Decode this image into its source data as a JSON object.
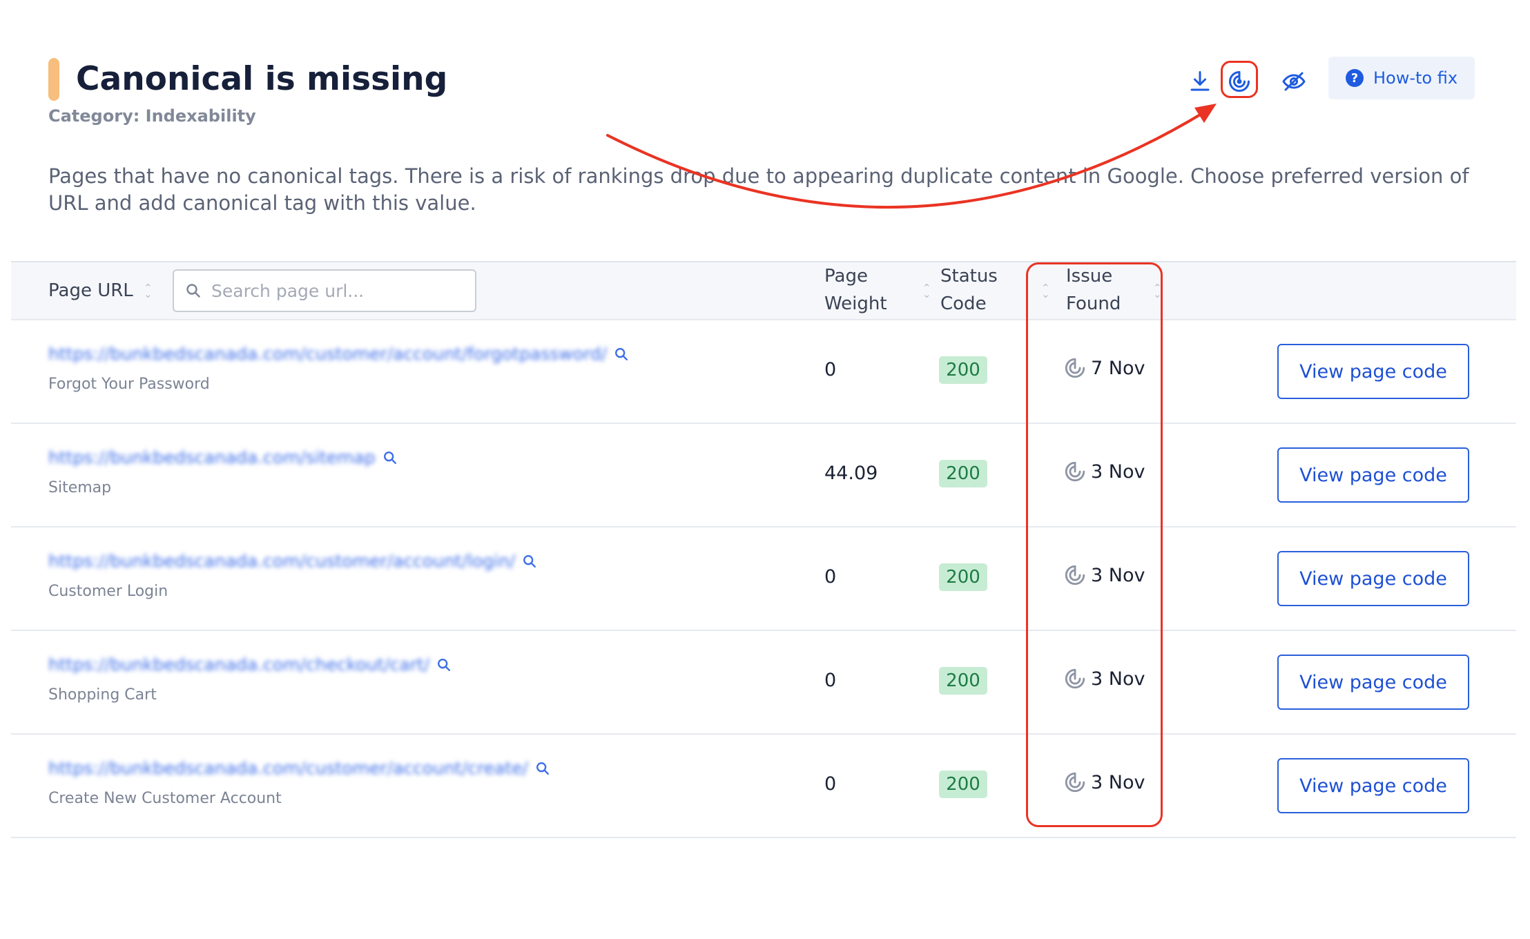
{
  "header": {
    "title": "Canonical is missing",
    "category": "Category: Indexability",
    "description": "Pages that have no canonical tags. There is a risk of rankings drop due to appearing duplicate content in Google. Choose preferred version of URL and add canonical tag with this value.",
    "accent_color": "#f7be7d"
  },
  "toolbar": {
    "download_icon": "download-icon",
    "issue_history_icon": "radar-icon",
    "hide_icon": "eye-off-icon",
    "howto_label": "How-to fix",
    "accent_color": "#1e5be0"
  },
  "table": {
    "columns": {
      "page_url": "Page URL",
      "search_placeholder": "Search page url...",
      "weight_line1": "Page",
      "weight_line2": "Weight",
      "status_line1": "Status",
      "status_line2": "Code",
      "found_line1": "Issue",
      "found_line2": "Found"
    },
    "rows": [
      {
        "url": "https://bunkbedscanada.com/customer/account/forgotpassword/",
        "title": "Forgot Your Password",
        "weight": "0",
        "status": "200",
        "found": "7 Nov",
        "action": "View page code"
      },
      {
        "url": "https://bunkbedscanada.com/sitemap",
        "title": "Sitemap",
        "weight": "44.09",
        "status": "200",
        "found": "3 Nov",
        "action": "View page code"
      },
      {
        "url": "https://bunkbedscanada.com/customer/account/login/",
        "title": "Customer Login",
        "weight": "0",
        "status": "200",
        "found": "3 Nov",
        "action": "View page code"
      },
      {
        "url": "https://bunkbedscanada.com/checkout/cart/",
        "title": "Shopping Cart",
        "weight": "0",
        "status": "200",
        "found": "3 Nov",
        "action": "View page code"
      },
      {
        "url": "https://bunkbedscanada.com/customer/account/create/",
        "title": "Create New Customer Account",
        "weight": "0",
        "status": "200",
        "found": "3 Nov",
        "action": "View page code"
      }
    ]
  },
  "colors": {
    "link": "#3d6ee8",
    "status_bg": "#c7ecd4",
    "status_text": "#1d7c44",
    "annotation": "#ea3323",
    "button_border": "#2a5fdc"
  }
}
